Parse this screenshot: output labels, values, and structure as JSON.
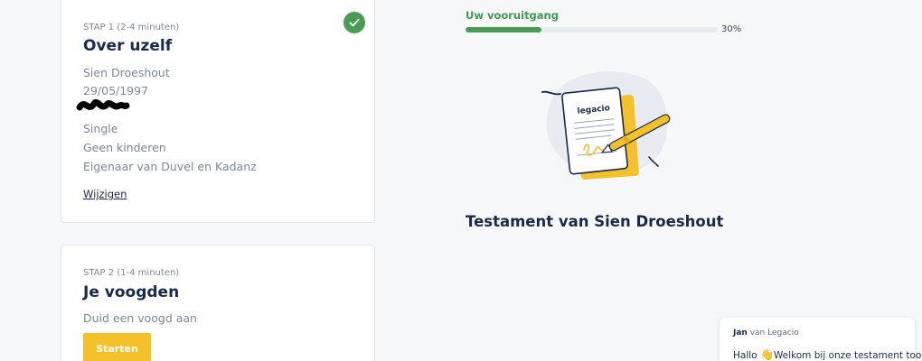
{
  "step1": {
    "label": "STAP 1 (2-4 minuten)",
    "title": "Over uzelf",
    "name": "Sien Droeshout",
    "birthdate": "29/05/1997",
    "status": "Single",
    "children": "Geen kinderen",
    "business": "Eigenaar van Duvel en Kadanz",
    "edit_label": "Wijzigen"
  },
  "step2": {
    "label": "STAP 2 (1-4 minuten)",
    "title": "Je voogden",
    "description": "Duid een voogd aan",
    "button_label": "Starten"
  },
  "progress": {
    "label": "Uw vooruitgang",
    "percent_text": "30%",
    "value": 0.3
  },
  "illustration": {
    "brand": "legacio"
  },
  "testament_title": "Testament van Sien Droeshout",
  "chat": {
    "author_name": "Jan",
    "author_suffix": "van Legacio",
    "greeting": "Hallo",
    "wave_emoji": "👋",
    "message": "Welkom bij onze testament tool"
  },
  "colors": {
    "accent_green": "#4a9b54",
    "button_yellow": "#f4c12b",
    "navy": "#1b2a4a"
  }
}
